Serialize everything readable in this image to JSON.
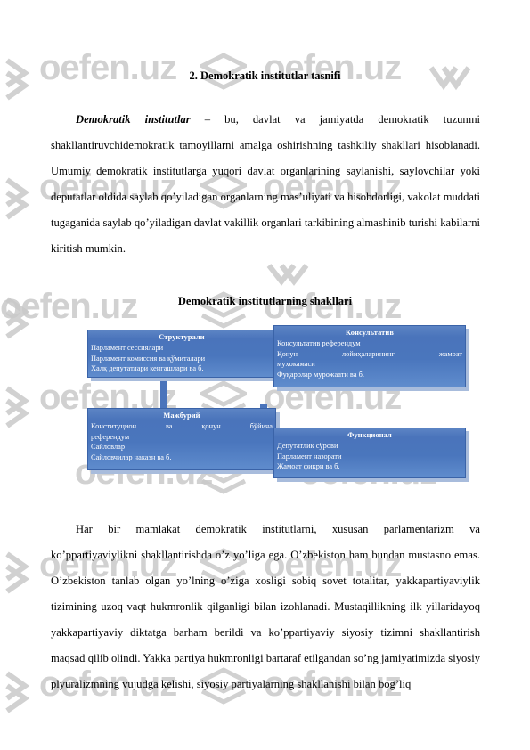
{
  "document": {
    "section_heading": "2.  Demokratik institutlar tasnifi",
    "paragraph_1_lead": "Demokratik   institutlar",
    "paragraph_1_rest": " – bu, davlat va jamiyatda demokratik tuzumni shakllantiruvchidemokratik tamoyillarni amalga oshirishning tashkiliy shakllari hisoblanadi. Umumiy demokratik institutlarga yuqori davlat organlarining saylanishi, saylovchilar yoki deputatlar oldida saylab qo’yiladigan organlarning mas’uliyati va hisobdorligi, vakolat muddati tugaganida saylab qo’yiladigan davlat vakillik organlari tarkibining almashinib turishi kabilarni kiritish mumkin.",
    "diagram_title": "Demokratik institutlarning shakllari",
    "paragraph_2": "Har bir mamlakat demokratik institutlarni, xususan parlamentarizm va ko’ppartiyaviylikni shakllantirishda o’z yo’liga ega. O’zbekiston ham bundan mustasno emas. O’zbekiston tanlab olgan yo’lning o’ziga xosligi sobiq sovet totalitar, yakkapartiyaviylik tizimining uzoq vaqt hukmronlik qilganligi bilan izohlanadi. Mustaqillikning ilk yillaridayoq yakkapartiyaviy diktatga barham berildi va ko’ppartiyaviy siyosiy tizimni shakllantirish maqsad qilib olindi. Yakka partiya hukmronligi bartaraf etilgandan so’ng jamiyatimizda siyosiy plyuralizmning vujudga kelishi, siyosiy partiyalarning shakllanishi bilan bog’liq"
  },
  "diagram": {
    "boxes": [
      {
        "id": "strukturali",
        "title": "Структурали",
        "lines": [
          "Парламент сессиялари",
          "Парламент комиссия ва қўмиталари",
          "Халқ депутатлари кенгашлари ва б."
        ]
      },
      {
        "id": "konsultativ",
        "title": "Консультатив",
        "lines": [
          "Консультатив референдум",
          "Қонун лойиҳаларининг жамоат",
          "муҳокамаси",
          "Фуқаролар мурожаати ва б."
        ],
        "justified_line_index": 1
      },
      {
        "id": "majburiy",
        "title": "Мажбурий",
        "lines": [
          "Конституцион ва қонун бўйича",
          "референдум",
          "Сайловлар",
          "Сайловчилар наказн ва б."
        ],
        "justified_line_index": 0
      },
      {
        "id": "funksional",
        "title": "Функционал",
        "lines": [
          "Депутатлик сўрови",
          "Парламент назорати",
          "Жамоат фикри ва б."
        ]
      }
    ],
    "colors": {
      "box_fill": "#4a74bb",
      "box_border": "#3a63a8",
      "box_shadow": "#a8bcdc",
      "box_text": "#ffffff"
    }
  },
  "watermark": {
    "text": "oefen.uz",
    "color": "#c9c9c9"
  }
}
